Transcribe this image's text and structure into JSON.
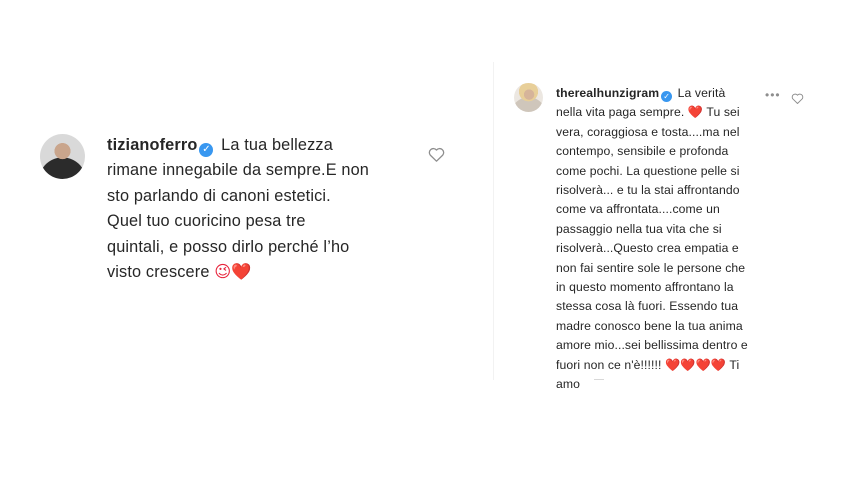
{
  "comments": [
    {
      "username": "tizianoferro",
      "verified_icon": "verified-badge-icon",
      "lines": [
        " La tua bellezza",
        "rimane innegabile da sempre.E non",
        "sto parlando di canoni estetici.",
        "Quel tuo cuoricino pesa tre",
        "quintali, e posso dirlo perché l’ho",
        "visto crescere"
      ],
      "end_emojis": "😉❤️",
      "like_icon": "heart-outline-icon"
    },
    {
      "username": "therealhunzigram",
      "verified_icon": "verified-badge-icon",
      "more_icon": "more-options-icon",
      "lines": [
        " La verità",
        "nella vita paga sempre.",
        "vera, coraggiosa e tosta....ma nel",
        "contempo, sensibile e profonda",
        "come pochi. La questione pelle si",
        "risolverà... e tu la stai affrontando",
        "come va affrontata....come un",
        "passaggio nella tua vita che si",
        "risolverà...Questo crea empatia e",
        "non fai sentire sole le persone che",
        "in questo momento affrontano la",
        "stessa cosa là fuori. Essendo tua",
        "madre conosco bene la tua anima",
        "amore mio...sei bellissima dentro e",
        "fuori non ce n'è!!!!!!",
        "amo"
      ],
      "line2_after_heart": " Tu sei",
      "line15_hearts": "❤️❤️❤️❤️",
      "line15_end": " Ti",
      "heart_emoji": "❤️",
      "like_icon": "heart-outline-icon"
    }
  ]
}
